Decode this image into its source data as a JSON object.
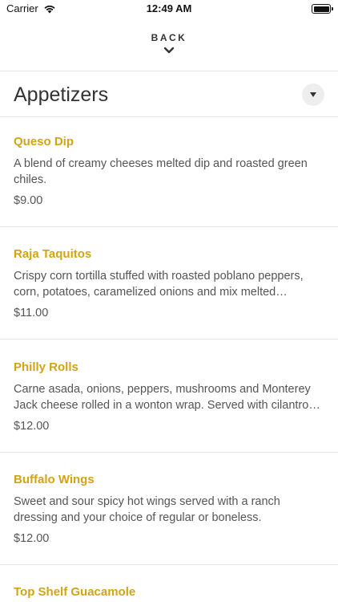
{
  "status_bar": {
    "carrier": "Carrier",
    "time": "12:49 AM"
  },
  "nav": {
    "back_label": "BACK"
  },
  "section": {
    "title": "Appetizers"
  },
  "menu_items": [
    {
      "name": "Queso Dip",
      "description": "A blend of creamy cheeses melted dip and roasted green chiles.",
      "price": "$9.00"
    },
    {
      "name": "Raja Taquitos",
      "description": "Crispy corn tortilla stuffed with roasted poblano peppers, corn, potatoes, caramelized onions and mix melted cheese…",
      "price": "$11.00"
    },
    {
      "name": "Philly Rolls",
      "description": "Carne asada, onions, peppers, mushrooms and Monterey Jack cheese rolled in a wonton wrap. Served with cilantro…",
      "price": "$12.00"
    },
    {
      "name": "Buffalo Wings",
      "description": "Sweet and sour spicy hot wings served with a ranch dressing and your choice of regular or boneless.",
      "price": "$12.00"
    },
    {
      "name": "Top Shelf Guacamole",
      "description": "",
      "price": ""
    }
  ],
  "colors": {
    "item_name": "#d2a413",
    "text": "#333333",
    "muted": "#555555",
    "divider": "#e6e6e6"
  },
  "icons": {
    "wifi": "wifi-icon",
    "battery": "battery-icon",
    "back": "chevron-down-icon",
    "collapse": "caret-down-icon"
  }
}
